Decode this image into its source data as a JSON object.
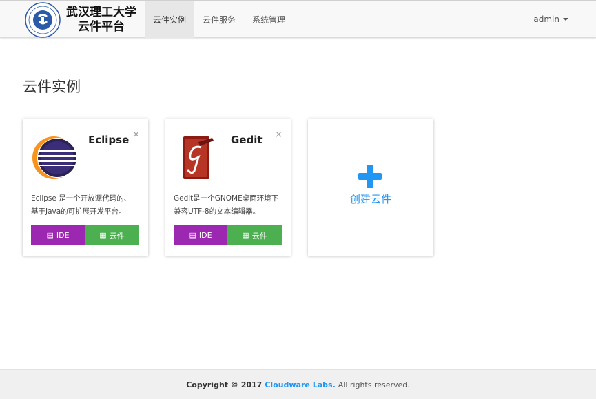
{
  "brand": {
    "line1": "武汉理工大学",
    "line2": "云件平台"
  },
  "nav": [
    {
      "label": "云件实例",
      "active": true
    },
    {
      "label": "云件服务",
      "active": false
    },
    {
      "label": "系统管理",
      "active": false
    }
  ],
  "user": {
    "name": "admin"
  },
  "page": {
    "title": "云件实例"
  },
  "cards": [
    {
      "name": "Eclipse",
      "desc_line1": "Eclipse 是一个开放源代码的、",
      "desc_line2": "基于Java的可扩展开发平台。",
      "btn_ide": "IDE",
      "btn_cloud": "云件",
      "close": "×"
    },
    {
      "name": "Gedit",
      "desc_line1": "Gedit是一个GNOME桌面环境下",
      "desc_line2": "兼容UTF-8的文本编辑器。",
      "btn_ide": "IDE",
      "btn_cloud": "云件",
      "close": "×"
    }
  ],
  "create": {
    "label": "创建云件"
  },
  "footer": {
    "copyright": "Copyright © 2017",
    "company": "Cloudware Labs.",
    "rights": "All rights reserved."
  },
  "colors": {
    "ide": "#9c27b0",
    "cloud": "#4caf50",
    "accent": "#2196f3"
  },
  "icons": [
    "university-logo",
    "close-icon",
    "eclipse-icon",
    "gedit-icon",
    "list-icon",
    "grid-icon",
    "plus-icon",
    "caret-down-icon"
  ]
}
